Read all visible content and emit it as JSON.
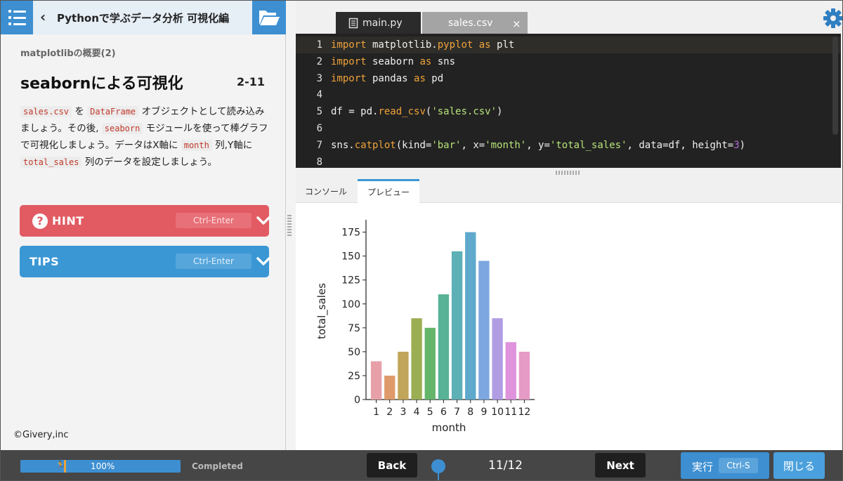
{
  "header": {
    "course_title": "Pythonで学ぶデータ分析 可視化編"
  },
  "lesson": {
    "section": "matplotlibの概要(2)",
    "title": "seabornによる可視化",
    "number": "2-11",
    "body": [
      {
        "t": "code",
        "v": "sales.csv"
      },
      {
        "t": "text",
        "v": " を "
      },
      {
        "t": "code",
        "v": "DataFrame"
      },
      {
        "t": "text",
        "v": " オブジェクトとして読み込みましょう。その後, "
      },
      {
        "t": "code",
        "v": "seaborn"
      },
      {
        "t": "text",
        "v": " モジュールを使って棒グラフで可視化しましょう。データはX軸に "
      },
      {
        "t": "code",
        "v": "month"
      },
      {
        "t": "text",
        "v": " 列,Y軸に "
      },
      {
        "t": "code",
        "v": "total_sales"
      },
      {
        "t": "text",
        "v": " 列のデータを設定しましょう。"
      }
    ]
  },
  "hint": {
    "label": "HINT",
    "shortcut": "Ctrl-Enter",
    "q": "?"
  },
  "tips": {
    "label": "TIPS",
    "shortcut": "Ctrl-Enter"
  },
  "copyright": "©Givery,inc",
  "editor": {
    "tabs": {
      "main": "main.py",
      "sales": "sales.csv",
      "close": "×"
    },
    "lines": [
      [
        {
          "c": "kw",
          "v": "import"
        },
        {
          "c": "code",
          "v": " matplotlib."
        },
        {
          "c": "fn",
          "v": "pyplot"
        },
        {
          "c": "code",
          "v": " "
        },
        {
          "c": "kw",
          "v": "as"
        },
        {
          "c": "code",
          "v": " plt"
        }
      ],
      [
        {
          "c": "kw",
          "v": "import"
        },
        {
          "c": "code",
          "v": " seaborn "
        },
        {
          "c": "kw",
          "v": "as"
        },
        {
          "c": "code",
          "v": " sns"
        }
      ],
      [
        {
          "c": "kw",
          "v": "import"
        },
        {
          "c": "code",
          "v": " pandas "
        },
        {
          "c": "kw",
          "v": "as"
        },
        {
          "c": "code",
          "v": " pd"
        }
      ],
      [],
      [
        {
          "c": "code",
          "v": "df = pd."
        },
        {
          "c": "fn",
          "v": "read_csv"
        },
        {
          "c": "code",
          "v": "("
        },
        {
          "c": "st",
          "v": "'sales.csv'"
        },
        {
          "c": "code",
          "v": ")"
        }
      ],
      [],
      [
        {
          "c": "code",
          "v": "sns."
        },
        {
          "c": "fn",
          "v": "catplot"
        },
        {
          "c": "code",
          "v": "(kind="
        },
        {
          "c": "st",
          "v": "'bar'"
        },
        {
          "c": "code",
          "v": ", x="
        },
        {
          "c": "st",
          "v": "'month'"
        },
        {
          "c": "code",
          "v": ", y="
        },
        {
          "c": "st",
          "v": "'total_sales'"
        },
        {
          "c": "code",
          "v": ", data=df, height="
        },
        {
          "c": "nm",
          "v": "3"
        },
        {
          "c": "code",
          "v": ")"
        }
      ],
      []
    ]
  },
  "output": {
    "tabs": {
      "console": "コンソール",
      "preview": "プレビュー"
    }
  },
  "chart_data": {
    "type": "bar",
    "categories": [
      "1",
      "2",
      "3",
      "4",
      "5",
      "6",
      "7",
      "8",
      "9",
      "10",
      "11",
      "12"
    ],
    "values": [
      40,
      25,
      50,
      85,
      75,
      110,
      155,
      175,
      145,
      85,
      60,
      50
    ],
    "colors": [
      "#e8a0a8",
      "#df9a6b",
      "#c0a55a",
      "#9bae53",
      "#64b56a",
      "#57b296",
      "#5cb0b6",
      "#5ea9cc",
      "#7ca7e0",
      "#b09de3",
      "#de93dc",
      "#e69ac6"
    ],
    "xlabel": "month",
    "ylabel": "total_sales",
    "ylim": [
      0,
      185
    ],
    "yticks": [
      0,
      25,
      50,
      75,
      100,
      125,
      150,
      175
    ],
    "grid": false
  },
  "footer": {
    "progress_percent": 100,
    "progress_text": "100%",
    "completed": "Completed",
    "back": "Back",
    "next": "Next",
    "page": "11/12",
    "run": "実行",
    "run_shortcut": "Ctrl-S",
    "close": "閉じる"
  }
}
